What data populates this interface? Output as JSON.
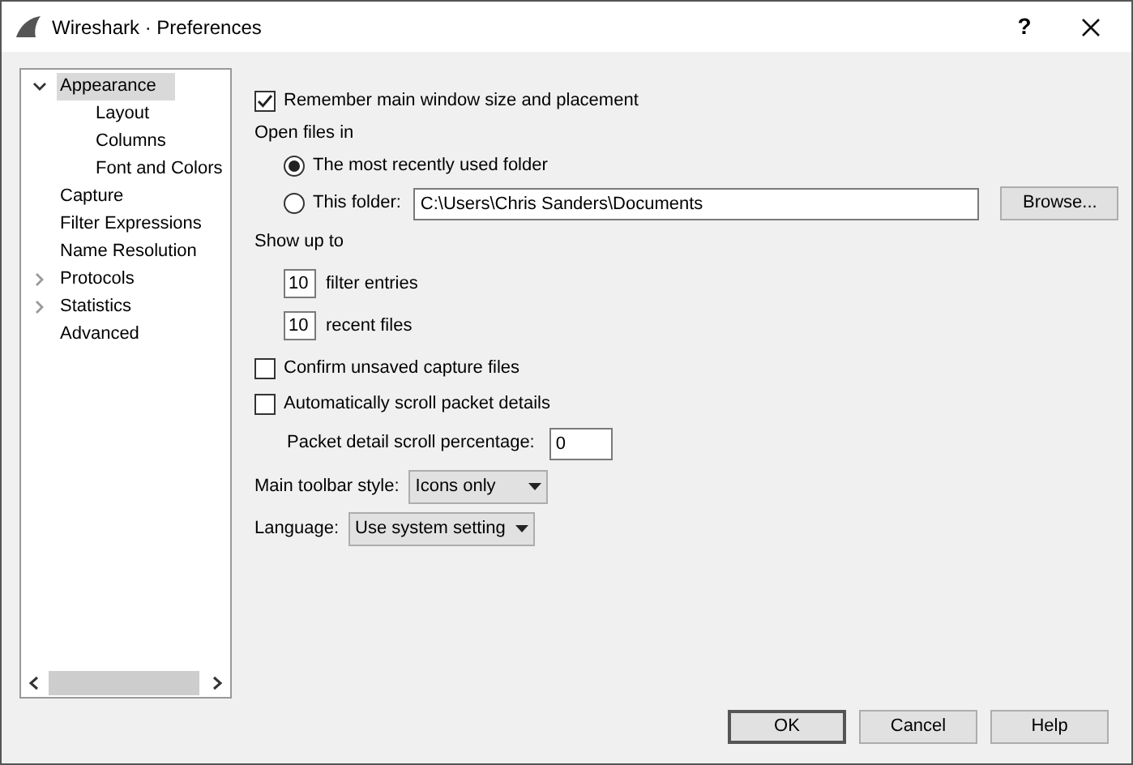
{
  "window": {
    "title": "Wireshark · Preferences",
    "help_button": "?"
  },
  "sidebar": {
    "items": [
      {
        "label": "Appearance",
        "selected": true,
        "expanded": true,
        "children": [
          {
            "label": "Layout",
            "selected": false
          },
          {
            "label": "Columns",
            "selected": false
          },
          {
            "label": "Font and Colors",
            "selected": false
          }
        ]
      },
      {
        "label": "Capture",
        "selected": false
      },
      {
        "label": "Filter Expressions",
        "selected": false
      },
      {
        "label": "Name Resolution",
        "selected": false
      },
      {
        "label": "Protocols",
        "selected": false,
        "expanded": false
      },
      {
        "label": "Statistics",
        "selected": false,
        "expanded": false
      },
      {
        "label": "Advanced",
        "selected": false
      }
    ]
  },
  "remember_window": {
    "label": "Remember main window size and placement",
    "checked": true
  },
  "open_files": {
    "heading": "Open files in",
    "options": [
      {
        "label": "The most recently used folder",
        "selected": true
      },
      {
        "label": "This folder:",
        "selected": false
      }
    ],
    "folder": {
      "value": "C:\\Users\\Chris Sanders\\Documents"
    },
    "browse_button": "Browse..."
  },
  "show_up_to": {
    "heading": "Show up to",
    "spinners": [
      {
        "value": "10",
        "label": "filter entries"
      },
      {
        "value": "10",
        "label": "recent files"
      }
    ]
  },
  "checkboxes": [
    {
      "label": "Confirm unsaved capture files",
      "checked": false
    },
    {
      "label": "Automatically scroll packet details",
      "checked": false
    }
  ],
  "scroll_percentage": {
    "label": "Packet detail scroll percentage:",
    "value": "0"
  },
  "toolbar_style": {
    "label": "Main toolbar style:",
    "value": "Icons only"
  },
  "language": {
    "label": "Language:",
    "value": "Use system setting"
  },
  "buttons": [
    {
      "label": "OK",
      "default": true
    },
    {
      "label": "Cancel",
      "default": false
    },
    {
      "label": "Help",
      "default": false
    }
  ]
}
